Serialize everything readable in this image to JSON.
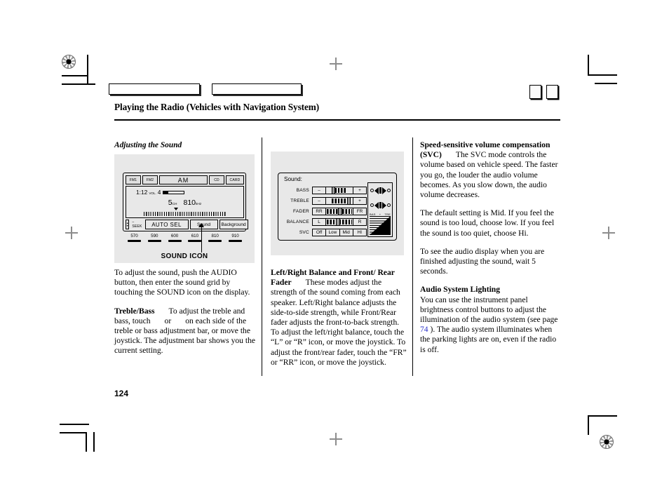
{
  "page": {
    "title": "Playing the Radio (Vehicles with Navigation System)",
    "number": "124"
  },
  "columns": {
    "left": {
      "section_heading": "Adjusting the Sound",
      "paragraph_1": "To adjust the sound, push the AUDIO button, then enter the sound grid by touching the SOUND icon on the display.",
      "heading_2": "Treble/Bass",
      "paragraph_2_part1": "To adjust the treble and bass, touch",
      "paragraph_2_part2": "or",
      "paragraph_2_part3": "on each side of the treble or bass adjustment bar, or move the joystick. The adjustment bar shows you the current setting."
    },
    "middle": {
      "heading": "Left/Right Balance and Front/ Rear Fader",
      "paragraph": "These modes adjust the strength of the sound coming from each speaker. Left/Right balance adjusts the side-to-side strength, while Front/Rear fader adjusts the front-to-back strength. To adjust the left/right balance, touch the “L” or “R” icon, or move the joystick. To adjust the front/rear fader, touch the “FR” or “RR” icon, or move the joystick."
    },
    "right": {
      "heading_1": "Speed-sensitive volume compensation (SVC)",
      "paragraph_1": "The SVC mode controls the volume based on vehicle speed. The faster you go, the louder the audio volume becomes. As you slow down, the audio volume decreases.",
      "paragraph_2": "The default setting is Mid. If you feel the sound is too loud, choose low. If you feel the sound is too quiet, choose Hi.",
      "paragraph_3": "To see the audio display when you are finished adjusting the sound, wait 5 seconds.",
      "heading_2": "Audio System Lighting",
      "paragraph_4_part1": "You can use the instrument panel brightness control buttons to adjust the illumination of the audio system (see page",
      "page_link": "74",
      "paragraph_4_part2": "). The audio system illuminates when the parking lights are on, even if the radio is off."
    }
  },
  "figure_radio": {
    "caption": "SOUND ICON",
    "source_buttons": [
      "FM1",
      "FM2",
      "AM",
      "CD",
      "CARD"
    ],
    "clock": "1:12",
    "volume_label": "VOL.",
    "volume_value": "4",
    "preset_channel_number": "5",
    "preset_channel_label": "CH",
    "frequency": "810",
    "frequency_unit": "kHz",
    "seek_label": "– SEEK",
    "seek_up": "▲",
    "seek_down": "▼",
    "soft_buttons": [
      "AUTO SEL",
      "Sound",
      "Background"
    ],
    "presets": [
      "570",
      "590",
      "600",
      "610",
      "810",
      "910"
    ]
  },
  "figure_sound": {
    "title": "Sound:",
    "rows": [
      {
        "label": "BASS",
        "left": "–",
        "right": "+",
        "fill_start_pct": 22,
        "fill_end_pct": 80,
        "marker_pct": 20
      },
      {
        "label": "TREBLE",
        "left": "–",
        "right": "+",
        "fill_start_pct": 20,
        "fill_end_pct": 82,
        "marker_pct": 80
      },
      {
        "label": "FADER",
        "left": "RR",
        "right": "FR",
        "fill_start_pct": 2,
        "fill_end_pct": 98,
        "marker_pct": 46
      },
      {
        "label": "BALANCE",
        "left": "L",
        "right": "R",
        "fill_start_pct": 2,
        "fill_end_pct": 98,
        "marker_pct": 38
      }
    ],
    "svc_label": "SVC",
    "svc_options": [
      "Off",
      "Low",
      "Mid",
      "HI"
    ],
    "eq_left_label": "BAS",
    "eq_center_label": "+",
    "eq_right_label": "TRE"
  },
  "colors": {
    "figure_background": "#e8e8e8",
    "page_link": "#2b32c8",
    "ink": "#000000"
  }
}
